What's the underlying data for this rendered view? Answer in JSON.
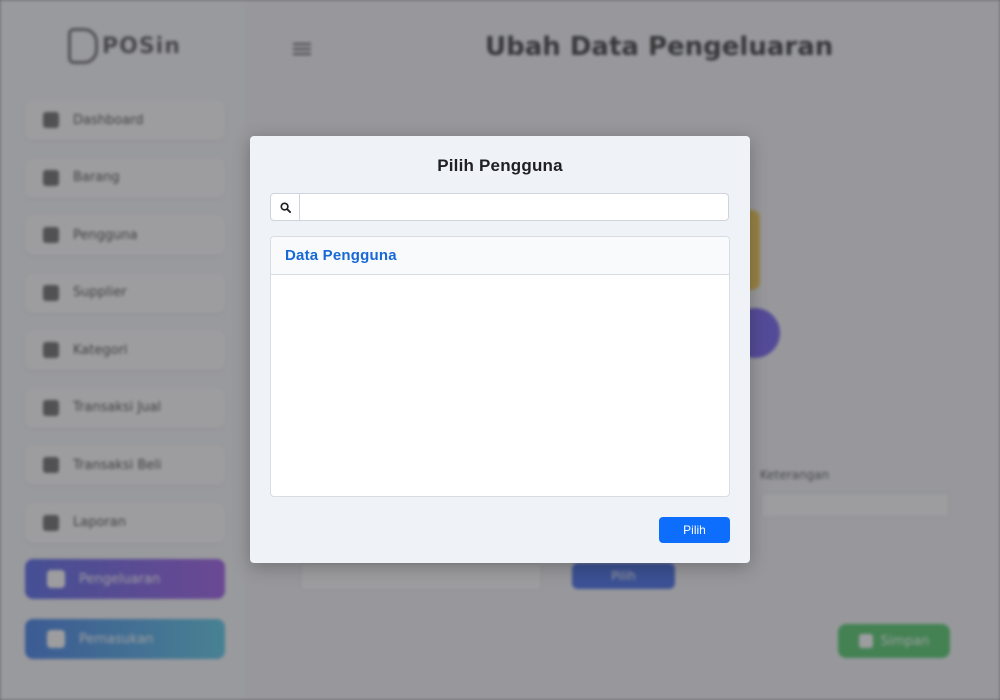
{
  "app": {
    "logo_text": "POSin",
    "page_title": "Ubah Data Pengeluaran",
    "sidebar": {
      "items": [
        {
          "label": "Dashboard",
          "icon": "search-icon"
        },
        {
          "label": "Barang",
          "icon": "box-icon"
        },
        {
          "label": "Pengguna",
          "icon": "user-icon"
        },
        {
          "label": "Supplier",
          "icon": "truck-icon"
        },
        {
          "label": "Kategori",
          "icon": "tag-icon"
        },
        {
          "label": "Transaksi Jual",
          "icon": "cart-icon"
        },
        {
          "label": "Transaksi Beli",
          "icon": "bag-icon"
        },
        {
          "label": "Laporan",
          "icon": "chart-icon"
        }
      ],
      "action_primary": "Pengeluaran",
      "action_secondary": "Pemasukan"
    },
    "form": {
      "side_label": "Keterangan",
      "blue_button": "Pilih",
      "save_button": "Simpan"
    }
  },
  "modal": {
    "title": "Pilih Pengguna",
    "search": {
      "value": "",
      "placeholder": ""
    },
    "panel_header": "Data Pengguna",
    "select_button": "Pilih"
  },
  "colors": {
    "primary": "#0d6efd",
    "header_text": "#1769d6",
    "modal_bg": "#eff3f8"
  }
}
